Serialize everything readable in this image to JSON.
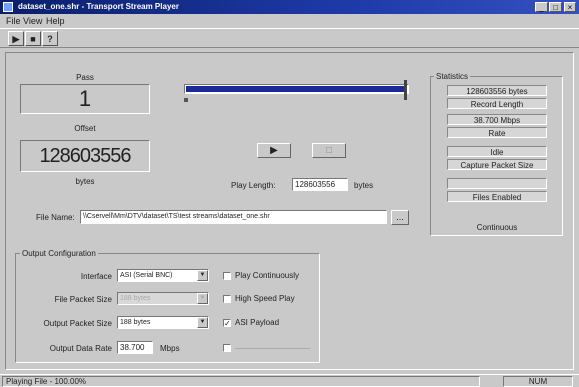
{
  "window": {
    "title": "dataset_one.shr - Transport Stream Player"
  },
  "menu": [
    "File",
    "View",
    "Help"
  ],
  "toolbar": {
    "b1": "▶",
    "b2": "■",
    "b3": "?"
  },
  "pass": {
    "label": "Pass",
    "value": "1"
  },
  "offset": {
    "label": "Offset",
    "value": "128603556",
    "units": "bytes"
  },
  "progress": {
    "fraction": 1.0
  },
  "controls": {
    "play": "▶",
    "stop": "□"
  },
  "play_length": {
    "label": "Play Length:",
    "value": "128603556",
    "units": "bytes"
  },
  "file": {
    "label": "File Name:",
    "value": "\\\\Cservell\\Mm\\DTV\\dataset\\TS\\test streams\\dataset_one.shr",
    "browse": "..."
  },
  "statistics": {
    "label": "Statistics",
    "items": [
      "128603556 bytes",
      "Record Length",
      "38.700 Mbps",
      "Rate",
      "Idle",
      "Capture Packet Size",
      "",
      "Files Enabled"
    ],
    "continuous": "Continuous"
  },
  "output": {
    "label": "Output Configuration",
    "interface": {
      "label": "Interface",
      "value": "ASI (Serial BNC)"
    },
    "file_packet_size": {
      "label": "File Packet Size",
      "value": "188 bytes"
    },
    "output_packet_size": {
      "label": "Output Packet Size",
      "value": "188 bytes"
    },
    "output_data_rate": {
      "label": "Output Data Rate",
      "value": "38.700",
      "units": "Mbps"
    },
    "checks": [
      {
        "label": "Play Continuously",
        "checked": false
      },
      {
        "label": "High Speed Play",
        "checked": false
      },
      {
        "label": "ASI Payload",
        "checked": true
      },
      {
        "label": "",
        "checked": false
      }
    ]
  },
  "status": {
    "left": "Playing File - 100.00%",
    "right": "NUM"
  },
  "colors": {
    "title_bg": "#0a1f6b",
    "progress": "#1a2a9a",
    "face": "#c9c9c9"
  }
}
